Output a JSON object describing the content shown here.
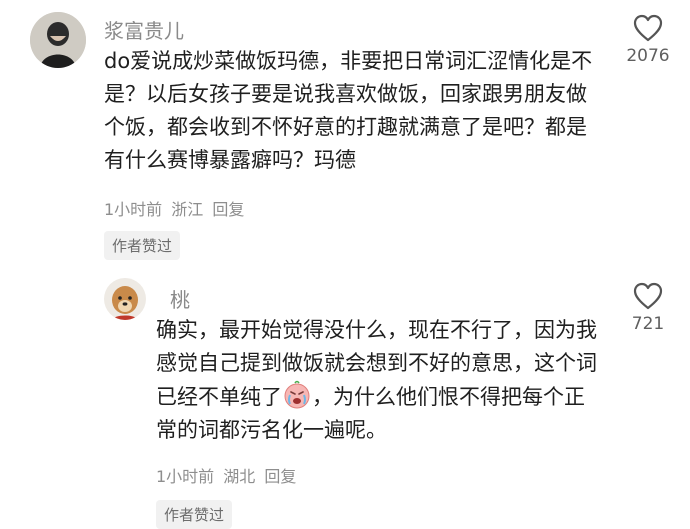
{
  "comment": {
    "username": "浆富贵儿",
    "text": "do爱说成炒菜做饭玛德，非要把日常词汇涩情化是不是？以后女孩子要是说我喜欢做饭，回家跟男朋友做个饭，都会收到不怀好意的打趣就满意了是吧？都是有什么赛博暴露癖吗？玛德",
    "time": "1小时前",
    "location": "浙江",
    "reply_label": "回复",
    "badge": "作者赞过",
    "likes": "2076"
  },
  "reply": {
    "username": "桃",
    "text_before": "确实，最开始觉得没什么，现在不行了，因为我感觉自己提到做饭就会想到不好的意思，这个词已经不单纯了",
    "text_after": "，为什么他们恨不得把每个正常的词都污名化一遍呢。",
    "emoji": "crying-face-emoji",
    "time": "1小时前",
    "location": "湖北",
    "reply_label": "回复",
    "badge": "作者赞过",
    "likes": "721"
  },
  "colors": {
    "username": "#8a8a8a",
    "meta": "#8e8e8e",
    "badge_bg": "#f1f1f1",
    "heart_stroke": "#555555"
  }
}
